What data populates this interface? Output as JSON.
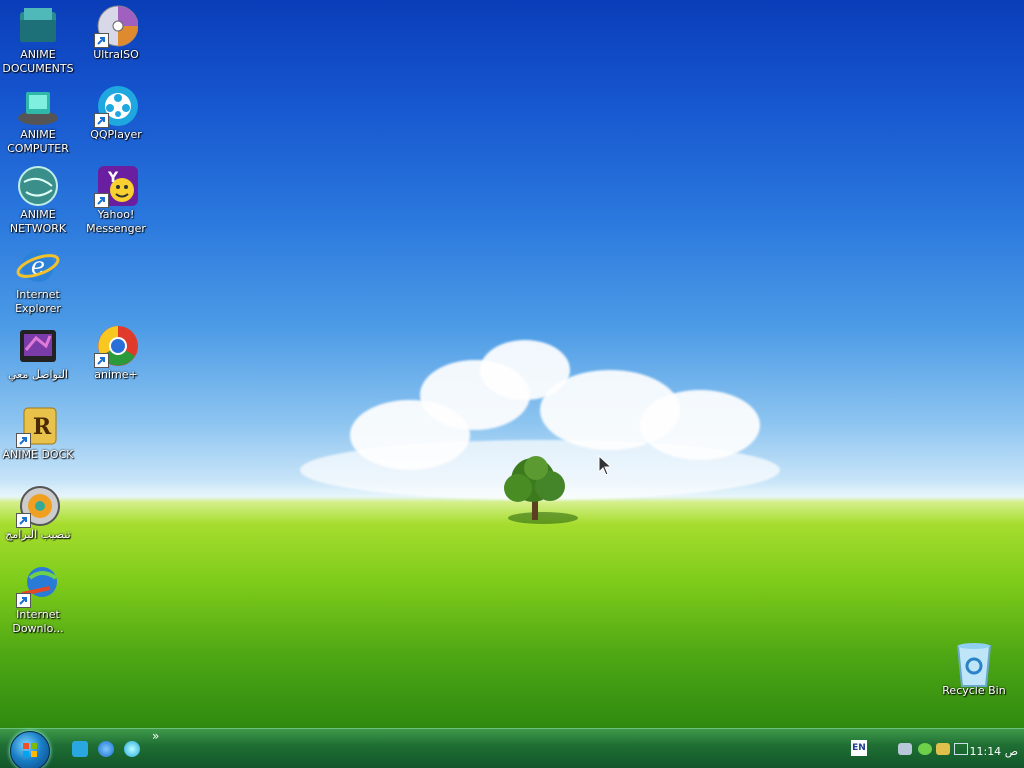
{
  "desktop": {
    "icons": [
      {
        "label": "ANIME DOCUMENTS",
        "icon": "folder-docs-icon"
      },
      {
        "label": "ANIME COMPUTER",
        "icon": "computer-icon"
      },
      {
        "label": "ANIME NETWORK",
        "icon": "network-globe-icon"
      },
      {
        "label": "Internet Explorer",
        "icon": "internet-explorer-icon"
      },
      {
        "label": "التواصل معي",
        "icon": "folder-purple-icon"
      },
      {
        "label": "ANIME DOCK",
        "icon": "dock-r-icon"
      },
      {
        "label": "تنصيب البرامج",
        "icon": "installer-disc-icon"
      },
      {
        "label": "Internet Downlo...",
        "icon": "download-manager-icon"
      },
      {
        "label": "UltraISO",
        "icon": "disc-icon"
      },
      {
        "label": "QQPlayer",
        "icon": "qqplayer-icon"
      },
      {
        "label": "Yahoo! Messenger",
        "icon": "yahoo-messenger-icon"
      },
      {
        "label": "anime+",
        "icon": "chrome-icon"
      },
      {
        "label": "Recycle Bin",
        "icon": "recycle-bin-icon"
      }
    ]
  },
  "taskbar": {
    "start_button": "start-orb-icon",
    "quick_launch": [
      "show-desktop-icon",
      "internet-explorer-icon",
      "qqplayer-icon"
    ],
    "overflow": "»",
    "language": "EN",
    "clock": "11:14 ص",
    "tray_icons": [
      "speaker-icon",
      "network-icon",
      "update-icon",
      "keyboard-icon"
    ]
  },
  "colors": {
    "sky_top": "#0a3db8",
    "grass": "#7ecb1a",
    "taskbar": "#1f6f33"
  }
}
